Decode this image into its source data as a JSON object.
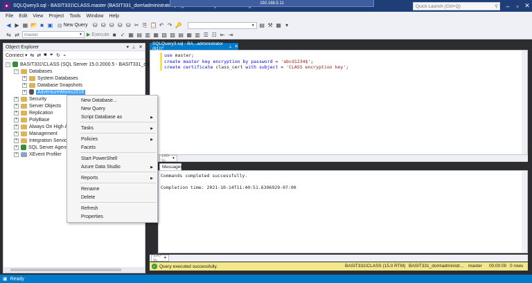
{
  "window": {
    "title": "SQLQuery3.sql - BASIT331\\CLASS.master (BASIT331_dom\\administrator (61)) - Microsoft SQL Server Management Studio",
    "remote_host": "192.168.5.11",
    "quick_launch_placeholder": "Quick Launch (Ctrl+Q)"
  },
  "menu": [
    "File",
    "Edit",
    "View",
    "Project",
    "Tools",
    "Window",
    "Help"
  ],
  "toolbar": {
    "new_query_label": "New Query",
    "database_combo": "master",
    "execute_label": "Execute"
  },
  "object_explorer": {
    "title": "Object Explorer",
    "connect_label": "Connect",
    "server": "BASIT331\\CLASS (SQL Server 15.0.2000.5 - BASIT331_dom\\Ad",
    "nodes": {
      "databases": "Databases",
      "system_databases": "System Databases",
      "database_snapshots": "Database Snapshots",
      "adventureworks": "AdventureWorks2016",
      "security": "Security",
      "server_objects": "Server Objects",
      "replication": "Replication",
      "polybase": "PolyBase",
      "always_on": "Always On High Av",
      "management": "Management",
      "integration_services": "Integration Service",
      "sql_server_agent": "SQL Server Agent",
      "xevent_profiler": "XEvent Profiler"
    }
  },
  "context_menu": {
    "new_database": "New Database...",
    "new_query": "New Query",
    "script_database_as": "Script Database as",
    "tasks": "Tasks",
    "policies": "Policies",
    "facets": "Facets",
    "start_powershell": "Start PowerShell",
    "azure_data_studio": "Azure Data Studio",
    "reports": "Reports",
    "rename": "Rename",
    "delete": "Delete",
    "refresh": "Refresh",
    "properties": "Properties"
  },
  "editor": {
    "tab_label": "SQLQuery3.sql - BA...administrator (61))*",
    "line1_kw": "use",
    "line1_rest": " master;",
    "line2_kw": "create master key encryption by password",
    "line2_eq": " = ",
    "line2_str": "'abcd1234$'",
    "line2_end": ";",
    "line3_kw": "create certificate",
    "line3_mid": " class_cert ",
    "line3_kw2": "with subject",
    "line3_eq": " = ",
    "line3_str": "'CLASS encryption key'",
    "line3_end": ";",
    "zoom": "100 %"
  },
  "results": {
    "tab_label": "Messages",
    "line1": "Commands completed successfully.",
    "line2": "Completion time: 2021-10-14T11:40:51.6396929-07:00",
    "zoom": "100 %"
  },
  "query_status": {
    "message": "Query executed successfully.",
    "server": "BASIT331\\CLASS (15.0 RTM)",
    "user": "BASIT331_dom\\administr...",
    "database": "master",
    "elapsed": "00:00:00",
    "rows": "0 rows"
  },
  "statusbar": {
    "text": "Ready"
  }
}
